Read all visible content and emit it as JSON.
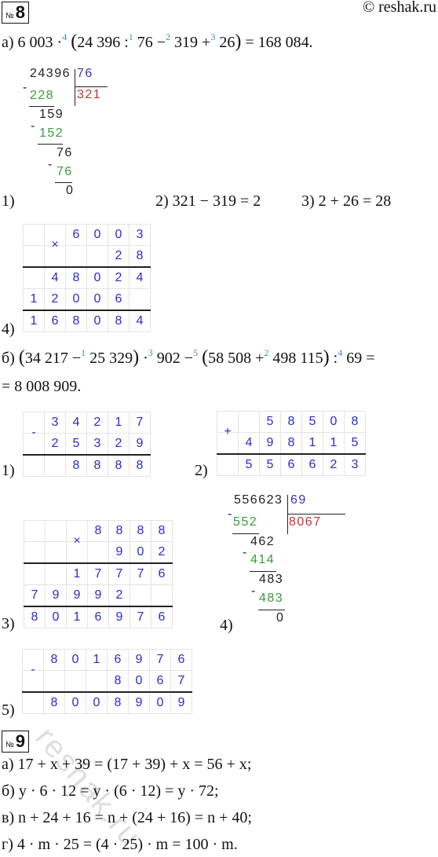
{
  "header": {
    "number_no": "№",
    "task8": "8",
    "task9": "9",
    "copyright": "© reshak.ru"
  },
  "task8": {
    "a": {
      "equation": [
        {
          "t": "а) 6 003 ·"
        },
        {
          "s": "4"
        },
        {
          "t": " "
        },
        {
          "p": "("
        },
        {
          "t": "24 396 :"
        },
        {
          "s": "1"
        },
        {
          "t": " 76 −"
        },
        {
          "s": "2"
        },
        {
          "t": " 319 +"
        },
        {
          "s": "3"
        },
        {
          "t": " 26"
        },
        {
          "p": ")"
        },
        {
          "t": " = 168 084."
        }
      ],
      "step1_label": "1)",
      "division": {
        "dividend": "24396",
        "divisor": "76",
        "quotient": "321",
        "steps": [
          "228",
          "159",
          "152",
          "76",
          "76",
          "0"
        ],
        "minus": "-"
      },
      "step2": "2) 321 − 319 = 2",
      "step3": "3) 2 + 26 = 28",
      "step4_label": "4)",
      "step4_grid": [
        [
          "",
          "×",
          "6",
          "0",
          "0",
          "3"
        ],
        [
          "",
          "",
          "",
          "",
          "2",
          "8"
        ],
        [
          "",
          "4",
          "8",
          "0",
          "2",
          "4"
        ],
        [
          "1",
          "2",
          "0",
          "0",
          "6",
          ""
        ],
        [
          "1",
          "6",
          "8",
          "0",
          "8",
          "4"
        ]
      ]
    },
    "b": {
      "equation": [
        {
          "t": "б) "
        },
        {
          "p": "("
        },
        {
          "t": "34 217 −"
        },
        {
          "s": "1"
        },
        {
          "t": " 25 329"
        },
        {
          "p": ")"
        },
        {
          "t": " ·"
        },
        {
          "s": "3"
        },
        {
          "t": " 902 −"
        },
        {
          "s": "5"
        },
        {
          "t": " "
        },
        {
          "p": "("
        },
        {
          "t": "58 508 +"
        },
        {
          "s": "2"
        },
        {
          "t": " 498 115"
        },
        {
          "p": ")"
        },
        {
          "t": " :"
        },
        {
          "s": "4"
        },
        {
          "t": " 69 ="
        }
      ],
      "equation_cont": "= 8 008 909.",
      "step1_label": "1)",
      "step1_grid": [
        [
          "-",
          "3",
          "4",
          "2",
          "1",
          "7"
        ],
        [
          "",
          "2",
          "5",
          "3",
          "2",
          "9"
        ],
        [
          "",
          "",
          "8",
          "8",
          "8",
          "8"
        ]
      ],
      "step2_label": "2)",
      "step2_grid": [
        [
          "+",
          "",
          "5",
          "8",
          "5",
          "0",
          "8"
        ],
        [
          "",
          "4",
          "9",
          "8",
          "1",
          "1",
          "5"
        ],
        [
          "",
          "5",
          "5",
          "6",
          "6",
          "2",
          "3"
        ]
      ],
      "step3_label": "3)",
      "step3_grid": [
        [
          "",
          "",
          "×",
          "8",
          "8",
          "8",
          "8"
        ],
        [
          "",
          "",
          "",
          "",
          "9",
          "0",
          "2"
        ],
        [
          "",
          "",
          "1",
          "7",
          "7",
          "7",
          "6"
        ],
        [
          "7",
          "9",
          "9",
          "9",
          "2",
          "",
          ""
        ],
        [
          "8",
          "0",
          "1",
          "6",
          "9",
          "7",
          "6"
        ]
      ],
      "step4_label": "4)",
      "division": {
        "dividend": "556623",
        "divisor": "69",
        "quotient": "8067",
        "steps": [
          "552",
          "462",
          "414",
          "483",
          "483",
          "0"
        ],
        "minus": "-"
      },
      "step5_label": "5)",
      "step5_grid": [
        [
          "-",
          "8",
          "0",
          "1",
          "6",
          "9",
          "7",
          "6"
        ],
        [
          "",
          "",
          "",
          "",
          "8",
          "0",
          "6",
          "7"
        ],
        [
          "",
          "8",
          "0",
          "0",
          "8",
          "9",
          "0",
          "9"
        ]
      ]
    }
  },
  "task9": {
    "lines": [
      "а) 17 + x + 39 = (17 + 39) + x = 56 + x;",
      "б) y · 6 · 12 = y · (6 · 12) = y · 72;",
      "в) n + 24 + 16 = n + (24 + 16) = n + 40;",
      "г) 4 · m · 25 = (4 · 25) · m = 100 · m."
    ]
  },
  "watermark": "reshak.ru",
  "colors": {
    "quotient": "#c83232",
    "divisor": "#3434c8",
    "subtrahend": "#3a9b3a",
    "grid_digits": "#2a2ad0",
    "step_markers": "#3a8ad8"
  }
}
